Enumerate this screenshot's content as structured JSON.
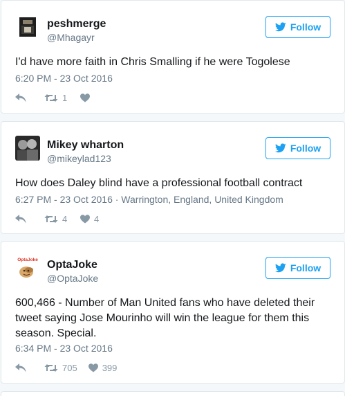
{
  "colors": {
    "accent": "#1da1f2",
    "text": "#14171a",
    "secondary": "#657786",
    "action": "#8899a6",
    "border": "#e1e8ed",
    "background": "#f5f8fa"
  },
  "tweets": [
    {
      "name": "peshmerge",
      "handle": "@Mhagayr",
      "follow_label": "Follow",
      "text": "I'd have more faith in Chris Smalling if he were Togolese",
      "timestamp": "6:20 PM - 23 Oct 2016",
      "location": "",
      "retweets": "1",
      "likes": "",
      "icons": [
        "reply-icon",
        "retweet-icon",
        "like-icon",
        "twitter-bird-icon"
      ]
    },
    {
      "name": "Mikey wharton",
      "handle": "@mikeylad123",
      "follow_label": "Follow",
      "text": "How does Daley blind have a professional football contract",
      "timestamp": "6:27 PM - 23 Oct 2016",
      "location": " · Warrington, England, United Kingdom",
      "retweets": "4",
      "likes": "4",
      "icons": [
        "reply-icon",
        "retweet-icon",
        "like-icon",
        "twitter-bird-icon"
      ]
    },
    {
      "name": "OptaJoke",
      "handle": "@OptaJoke",
      "avatar_text": "OptaJoke",
      "follow_label": "Follow",
      "text": "600,466 - Number of Man United fans who have deleted their tweet saying Jose Mourinho will win the league for them this season. Special.",
      "timestamp": "6:34 PM - 23 Oct 2016",
      "location": "",
      "retweets": "705",
      "likes": "399",
      "icons": [
        "reply-icon",
        "retweet-icon",
        "like-icon",
        "twitter-bird-icon"
      ]
    }
  ]
}
